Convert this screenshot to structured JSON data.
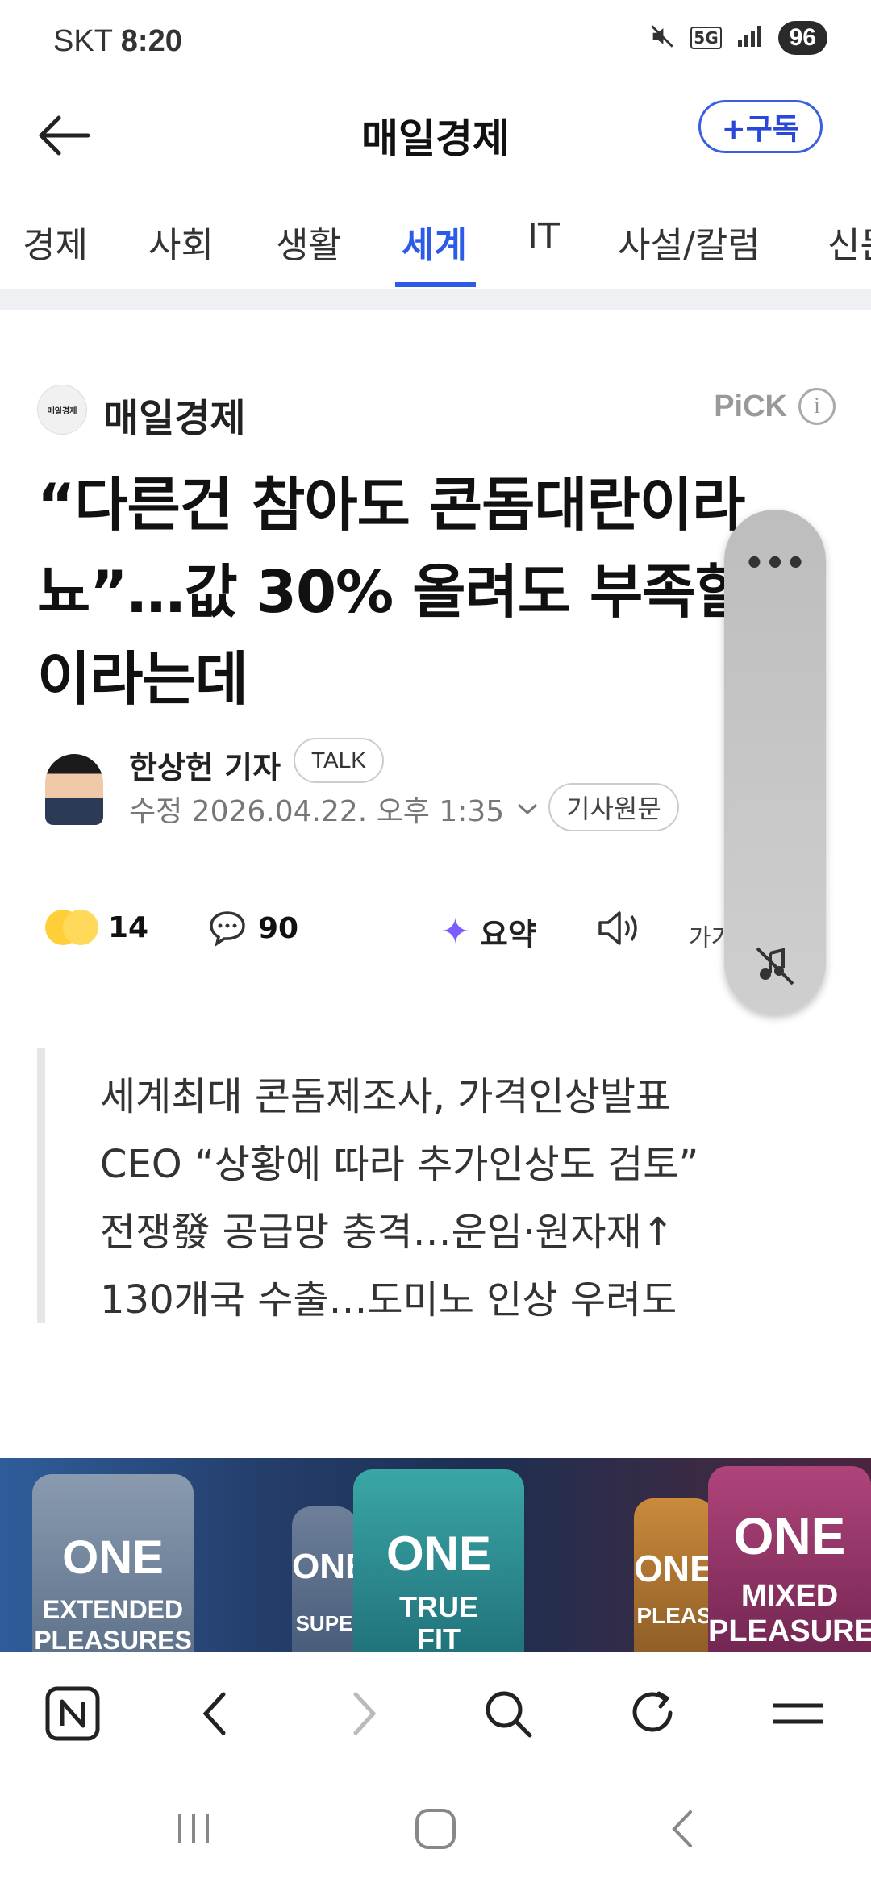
{
  "status_bar": {
    "carrier": "SKT",
    "time": "8:20",
    "network": "5G",
    "battery": "96"
  },
  "header": {
    "title": "매일경제",
    "subscribe_label": "+구독"
  },
  "tabs": [
    {
      "label": "경제"
    },
    {
      "label": "사회"
    },
    {
      "label": "생활"
    },
    {
      "label": "세계"
    },
    {
      "label": "IT"
    },
    {
      "label": "사설/칼럼"
    },
    {
      "label": "신문"
    }
  ],
  "article": {
    "press_name": "매일경제",
    "press_logo_text": "매일경제",
    "pick_label": "PiCK",
    "headline": "“다른건 참아도 콘돔대란이라뇨”…값 30% 올려도 부족할 판이라는데",
    "reporter": "한상헌 기자",
    "talk_label": "TALK",
    "date_line": "수정 2026.04.22. 오후 1:35",
    "original_label": "기사원문",
    "reactions_count": "14",
    "comments_count": "90",
    "summary_label": "요약",
    "font_label": "가가",
    "summary_lines": [
      "세계최대 콘돔제조사, 가격인상발표",
      "CEO “상황에 따라 추가인상도 검토”",
      "전쟁發 공급망 충격…운임·원자재↑",
      "130개국 수출…도미노 인상 우려도"
    ]
  },
  "hero_image": {
    "labels": [
      "ONE",
      "EXTENDED",
      "PLEASURES",
      "ONE",
      "SUPE",
      "ONE",
      "TRUE",
      "FIT",
      "ONE",
      "PLEAS",
      "ONE",
      "MIXED",
      "PLEASURE"
    ]
  }
}
